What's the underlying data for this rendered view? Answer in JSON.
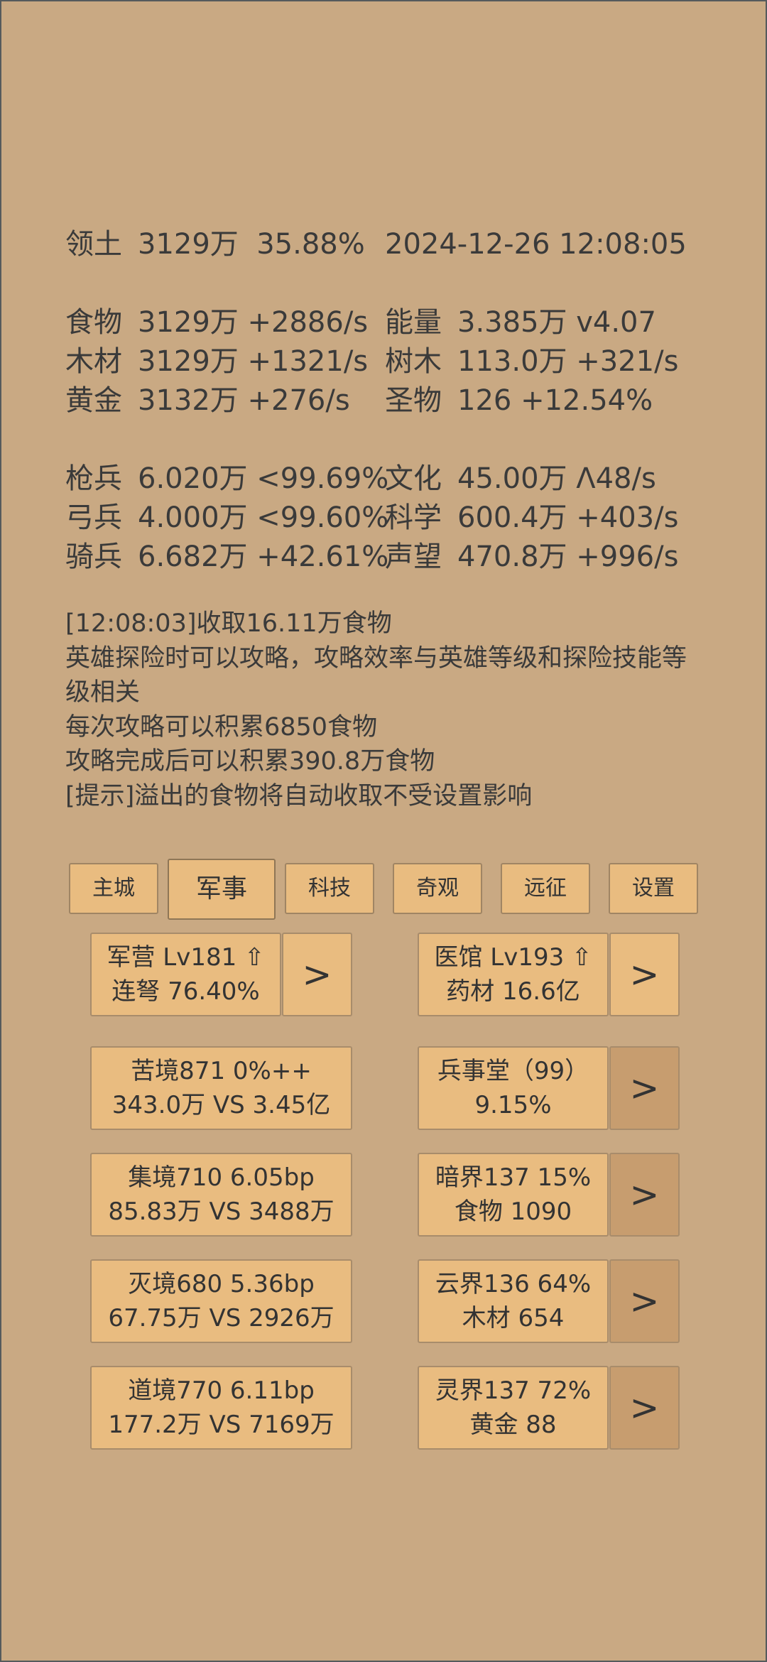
{
  "stats": {
    "territory": {
      "name": "领土",
      "value": "3129万",
      "pct": "35.88%"
    },
    "datetime": "2024-12-26 12:08:05",
    "resources": [
      {
        "name": "食物",
        "text": "3129万 +2886/s"
      },
      {
        "name": "能量",
        "text": "3.385万  v4.07"
      },
      {
        "name": "木材",
        "text": "3129万 +1321/s"
      },
      {
        "name": "树木",
        "text": "113.0万 +321/s"
      },
      {
        "name": "黄金",
        "text": "3132万 +276/s"
      },
      {
        "name": "圣物",
        "text": "126 +12.54%"
      }
    ],
    "troops": [
      {
        "name": "枪兵",
        "text": "6.020万 <99.69%"
      },
      {
        "name": "文化",
        "text": "45.00万 Λ48/s"
      },
      {
        "name": "弓兵",
        "text": "4.000万 <99.60%"
      },
      {
        "name": "科学",
        "text": "600.4万 +403/s"
      },
      {
        "name": "骑兵",
        "text": "6.682万 +42.61%"
      },
      {
        "name": "声望",
        "text": "470.8万 +996/s"
      }
    ]
  },
  "log": [
    "[12:08:03]收取16.11万食物",
    "英雄探险时可以攻略，攻略效率与英雄等级和探险技能等级相关",
    "每次攻略可以积累6850食物",
    "攻略完成后可以积累390.8万食物",
    "[提示]溢出的食物将自动收取不受设置影响"
  ],
  "tabs": [
    "主城",
    "军事",
    "科技",
    "奇观",
    "远征",
    "设置"
  ],
  "active_tab": "军事",
  "buildings": {
    "barracks": {
      "line1": "军营 Lv181 ⇧",
      "line2": "连弩 76.40%"
    },
    "hospital": {
      "line1": "医馆 Lv193 ⇧",
      "line2": "药材 16.6亿"
    },
    "arrow": ">"
  },
  "realms": [
    {
      "line1": "苦境871  0%++",
      "line2": "343.0万 VS 3.45亿"
    },
    {
      "line1": "集境710  6.05bp",
      "line2": "85.83万 VS 3488万"
    },
    {
      "line1": "灭境680  5.36bp",
      "line2": "67.75万 VS 2926万"
    },
    {
      "line1": "道境770  6.11bp",
      "line2": "177.2万 VS 7169万"
    }
  ],
  "expeditions": [
    {
      "line1": "兵事堂（99）",
      "line2": "9.15%"
    },
    {
      "line1": "暗界137  15%",
      "line2": "食物 1090"
    },
    {
      "line1": "云界136  64%",
      "line2": "木材 654"
    },
    {
      "line1": "灵界137  72%",
      "line2": "黄金 88"
    }
  ],
  "colors": {
    "background": "#c9a983",
    "button": "#e9bc80",
    "button_dark": "#c79d6f",
    "text": "#3a3a3a"
  }
}
